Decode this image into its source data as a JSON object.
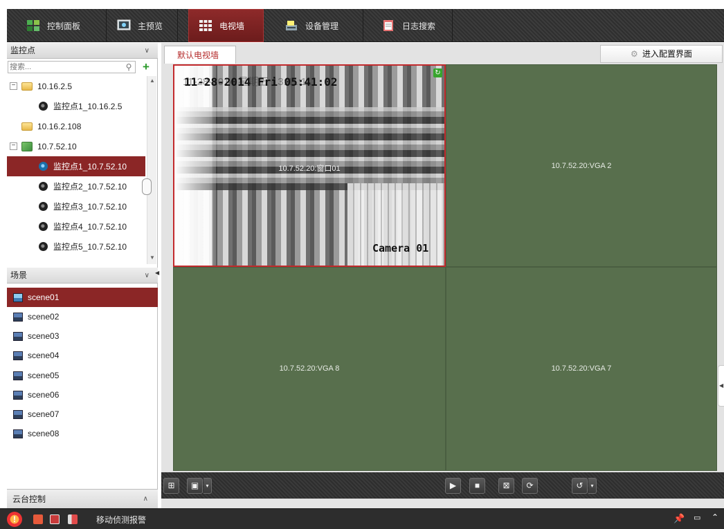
{
  "top_tabs": [
    {
      "label": "控制面板",
      "icon": "control-panel-icon",
      "active": false
    },
    {
      "label": "主预览",
      "icon": "main-preview-icon",
      "active": false
    },
    {
      "label": "电视墙",
      "icon": "video-wall-icon",
      "active": true
    },
    {
      "label": "设备管理",
      "icon": "device-management-icon",
      "active": false
    },
    {
      "label": "日志搜索",
      "icon": "log-search-icon",
      "active": false
    }
  ],
  "monitor_section": {
    "title": "监控点",
    "chevron": "∨"
  },
  "search": {
    "placeholder": "搜索..."
  },
  "tree": [
    {
      "label": "10.16.2.5",
      "type": "folder",
      "level": 0,
      "expander": "−"
    },
    {
      "label": "监控点1_10.16.2.5",
      "type": "camera",
      "level": 1
    },
    {
      "label": "10.16.2.108",
      "type": "folder",
      "level": 0
    },
    {
      "label": "10.7.52.10",
      "type": "map",
      "level": 0,
      "expander": "−"
    },
    {
      "label": "监控点1_10.7.52.10",
      "type": "camera",
      "level": 1,
      "selected": true
    },
    {
      "label": "监控点2_10.7.52.10",
      "type": "camera",
      "level": 1
    },
    {
      "label": "监控点3_10.7.52.10",
      "type": "camera",
      "level": 1
    },
    {
      "label": "监控点4_10.7.52.10",
      "type": "camera",
      "level": 1
    },
    {
      "label": "监控点5_10.7.52.10",
      "type": "camera",
      "level": 1
    }
  ],
  "scene_section": {
    "title": "场景",
    "chevron": "∨"
  },
  "scenes": [
    {
      "label": "scene01",
      "selected": true
    },
    {
      "label": "scene02"
    },
    {
      "label": "scene03"
    },
    {
      "label": "scene04"
    },
    {
      "label": "scene05"
    },
    {
      "label": "scene06"
    },
    {
      "label": "scene07"
    },
    {
      "label": "scene08"
    }
  ],
  "ptz": {
    "title": "云台控制",
    "chevron": "∧"
  },
  "wall": {
    "tab_label": "默认电视墙",
    "config_button": "进入配置界面",
    "cells": [
      {
        "label": "10.7.52.20:窗口01",
        "playing": true
      },
      {
        "label": "10.7.52.20:VGA 2"
      },
      {
        "label": "10.7.52.20:VGA 8"
      },
      {
        "label": "10.7.52.20:VGA 7"
      }
    ],
    "osd": {
      "datetime": "11-28-2014 Fri 05:41:02",
      "ghost_datetime": "11-28-2014 星期五 13:41:11",
      "camera_name": "Camera 01",
      "refresh_glyph": "↻"
    }
  },
  "toolbar": {
    "layout_glyph": "⊞",
    "screen_glyph": "▣",
    "drop_glyph": "▾",
    "play_glyph": "▶",
    "stop_glyph": "■",
    "clear_glyph": "⊠",
    "refresh_glyph": "⟳",
    "loop_glyph": "↺"
  },
  "statusbar": {
    "text": "移动侦测报警",
    "alarm_glyph": "!",
    "pin_glyph": "📌",
    "restore_glyph": "▭",
    "collapse_glyph": "⌃"
  },
  "colors": {
    "accent_red": "#8b2626",
    "active_tab_red": "#7f2323",
    "wall_green": "#586f4d",
    "refresh_green": "#37a52d"
  }
}
